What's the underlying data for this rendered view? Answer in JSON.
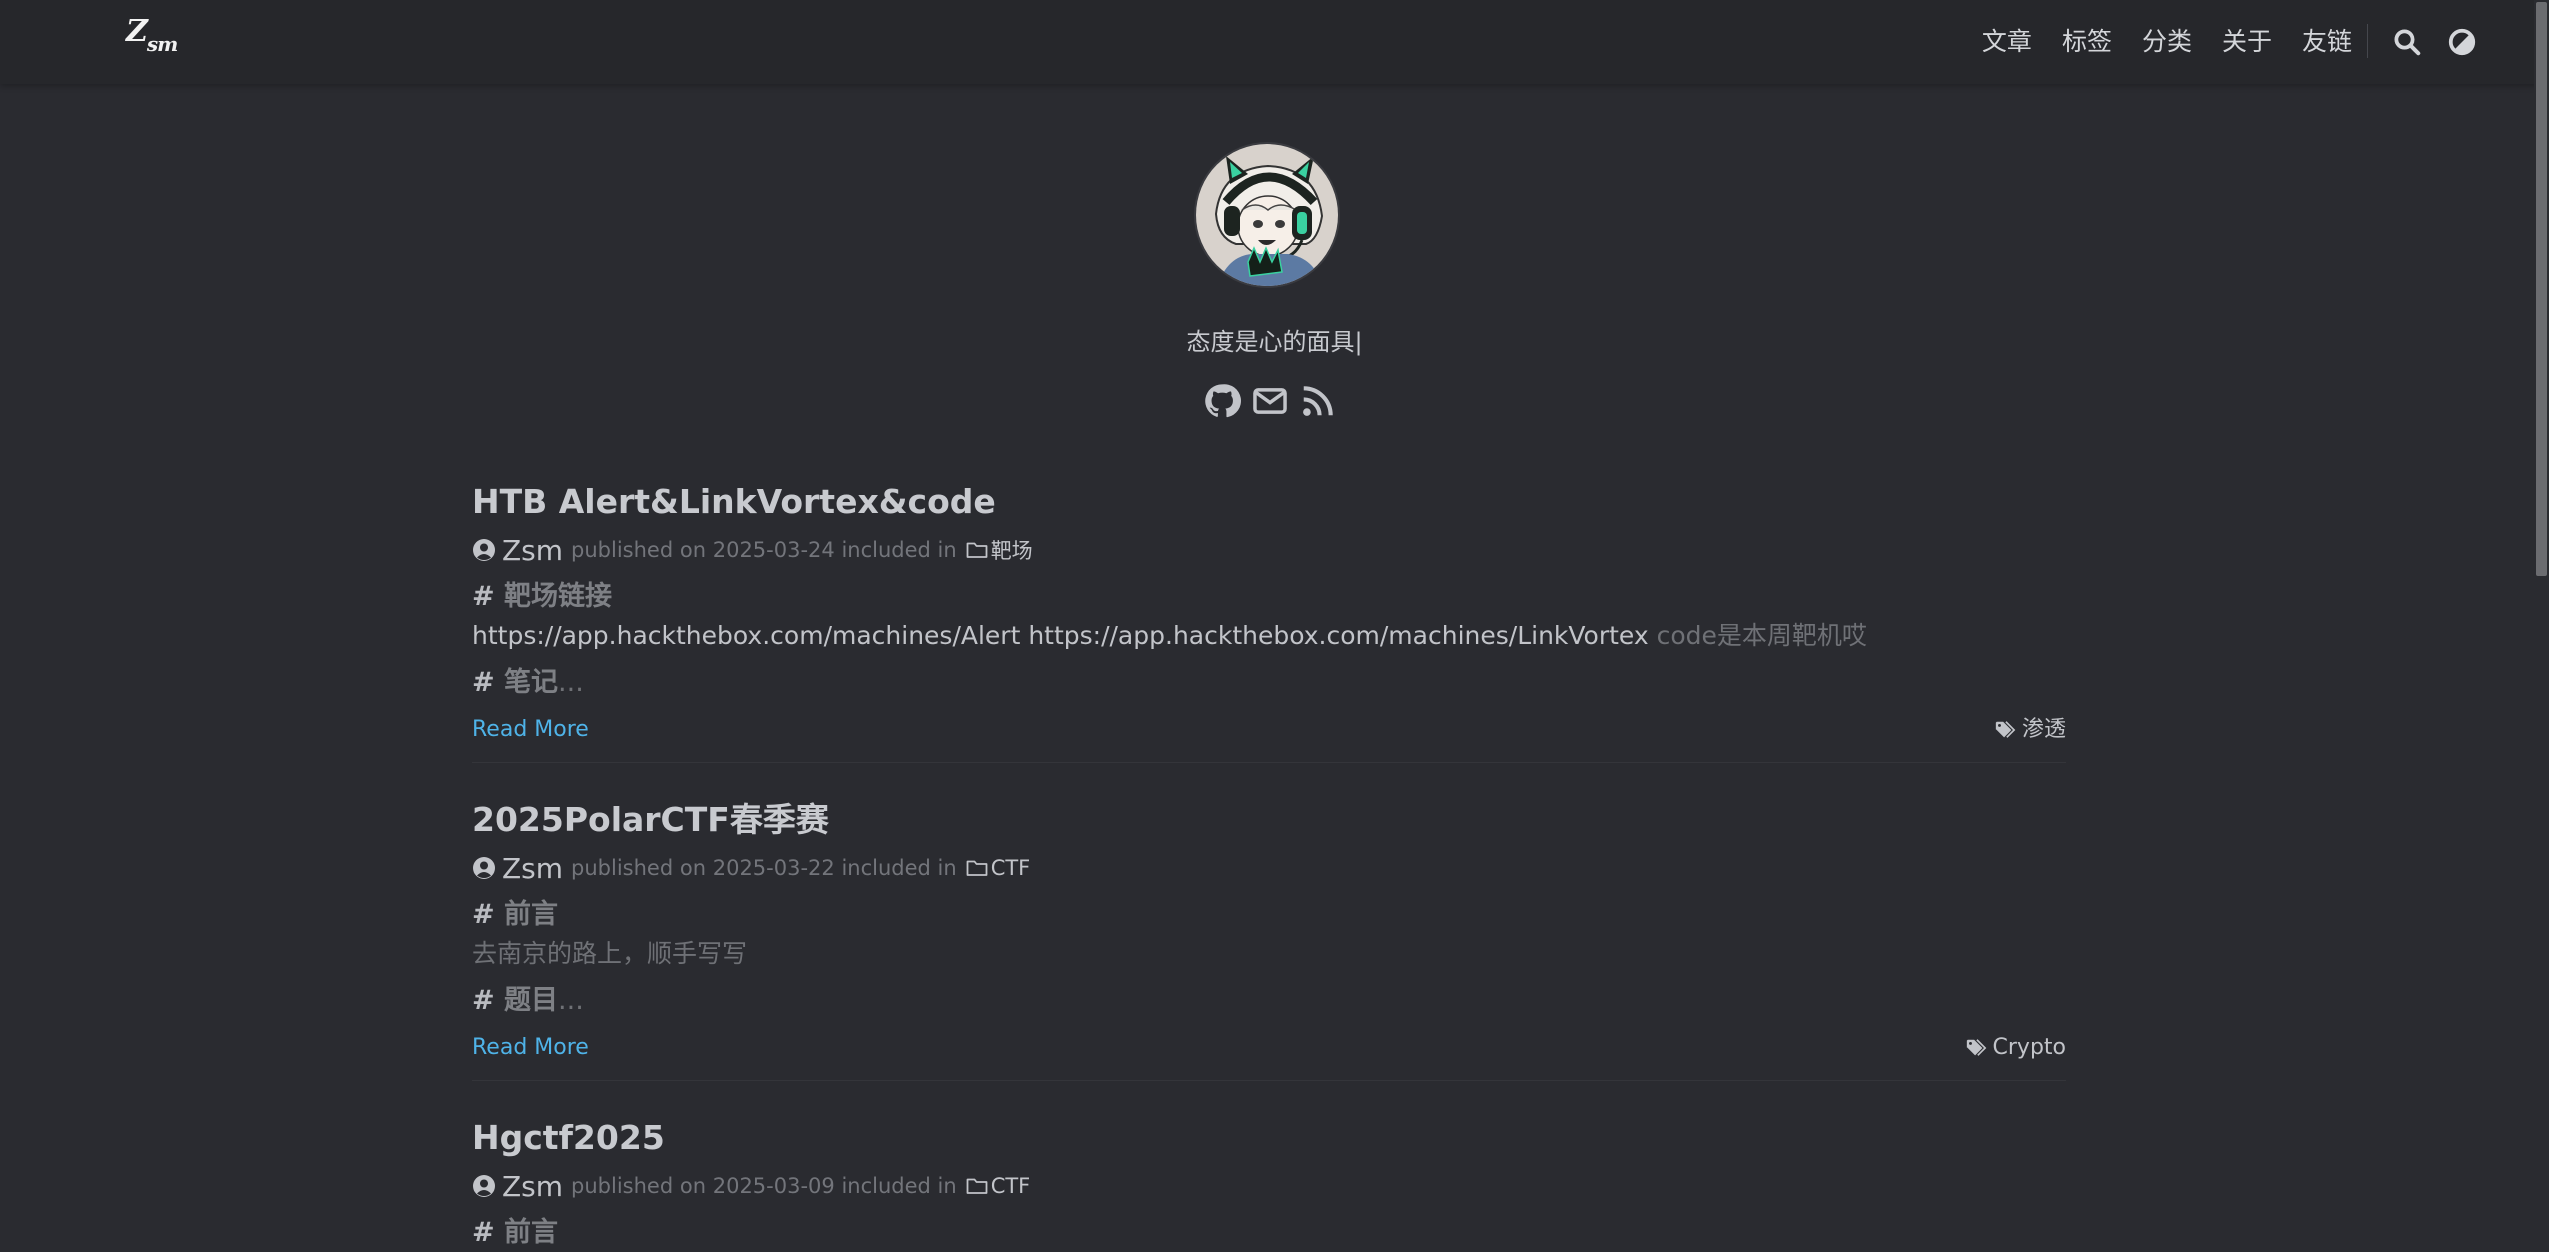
{
  "site": {
    "logo_main": "Z",
    "logo_small": "sm"
  },
  "nav": {
    "items": [
      {
        "label": "文章"
      },
      {
        "label": "标签"
      },
      {
        "label": "分类"
      },
      {
        "label": "关于"
      },
      {
        "label": "友链"
      }
    ],
    "search_icon": "search-icon",
    "theme_icon": "theme-toggle-icon"
  },
  "profile": {
    "motto": "态度是心的面具|",
    "social": [
      "github-icon",
      "mail-icon",
      "rss-icon"
    ]
  },
  "common": {
    "published_on": "published on",
    "included_in": "included in",
    "read_more": "Read More",
    "hash": "#",
    "ellipsis": "..."
  },
  "posts": [
    {
      "title": "HTB Alert&LinkVortex&code",
      "author": "Zsm",
      "date": "2025-03-24",
      "category": "靶场",
      "heading1": "靶场链接",
      "line_main": "https://app.hackthebox.com/machines/Alert https://app.hackthebox.com/machines/LinkVortex",
      "line_dim": "code是本周靶机哎",
      "heading2": "笔记",
      "tag": "渗透"
    },
    {
      "title": "2025PolarCTF春季赛",
      "author": "Zsm",
      "date": "2025-03-22",
      "category": "CTF",
      "heading1": "前言",
      "line_main": "",
      "line_dim": "去南京的路上，顺手写写",
      "heading2": "题目",
      "tag": "Crypto"
    },
    {
      "title": "Hgctf2025",
      "author": "Zsm",
      "date": "2025-03-09",
      "category": "CTF",
      "heading1": "前言"
    }
  ]
}
